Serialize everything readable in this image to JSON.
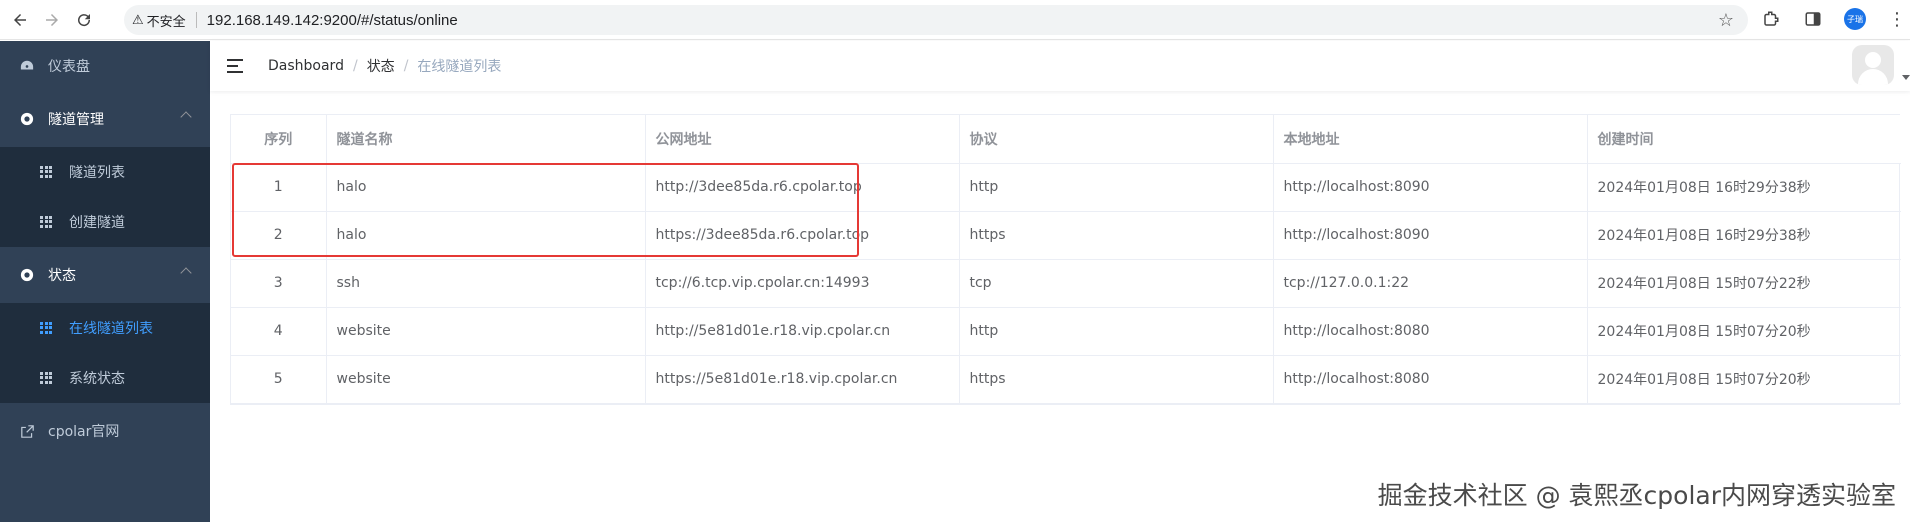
{
  "browser": {
    "security_label": "不安全",
    "url": "192.168.149.142:9200/#/status/online",
    "profile_label": "子瑞"
  },
  "sidebar": {
    "items": [
      {
        "label": "仪表盘",
        "icon": "dashboard-icon"
      },
      {
        "label": "隧道管理",
        "icon": "settings-circle-icon",
        "children": [
          {
            "label": "隧道列表",
            "icon": "table-icon"
          },
          {
            "label": "创建隧道",
            "icon": "table-icon"
          }
        ]
      },
      {
        "label": "状态",
        "icon": "settings-circle-icon",
        "children": [
          {
            "label": "在线隧道列表",
            "icon": "table-icon",
            "active": true
          },
          {
            "label": "系统状态",
            "icon": "table-icon"
          }
        ]
      },
      {
        "label": "cpolar官网",
        "icon": "external-link-icon"
      }
    ]
  },
  "breadcrumb": [
    "Dashboard",
    "状态",
    "在线隧道列表"
  ],
  "table": {
    "headers": [
      "序列",
      "隧道名称",
      "公网地址",
      "协议",
      "本地地址",
      "创建时间"
    ],
    "rows": [
      [
        "1",
        "halo",
        "http://3dee85da.r6.cpolar.top",
        "http",
        "http://localhost:8090",
        "2024年01月08日 16时29分38秒"
      ],
      [
        "2",
        "halo",
        "https://3dee85da.r6.cpolar.top",
        "https",
        "http://localhost:8090",
        "2024年01月08日 16时29分38秒"
      ],
      [
        "3",
        "ssh",
        "tcp://6.tcp.vip.cpolar.cn:14993",
        "tcp",
        "tcp://127.0.0.1:22",
        "2024年01月08日 15时07分22秒"
      ],
      [
        "4",
        "website",
        "http://5e81d01e.r18.vip.cpolar.cn",
        "http",
        "http://localhost:8080",
        "2024年01月08日 15时07分20秒"
      ],
      [
        "5",
        "website",
        "https://5e81d01e.r18.vip.cpolar.cn",
        "https",
        "http://localhost:8080",
        "2024年01月08日 15时07分20秒"
      ]
    ]
  },
  "watermark": "掘金技术社区 @ 袁熙丞cpolar内网穿透实验室",
  "colors": {
    "sidebar_bg": "#304156",
    "submenu_bg": "#1f2d3d",
    "active": "#409eff",
    "highlight": "#e53935"
  }
}
